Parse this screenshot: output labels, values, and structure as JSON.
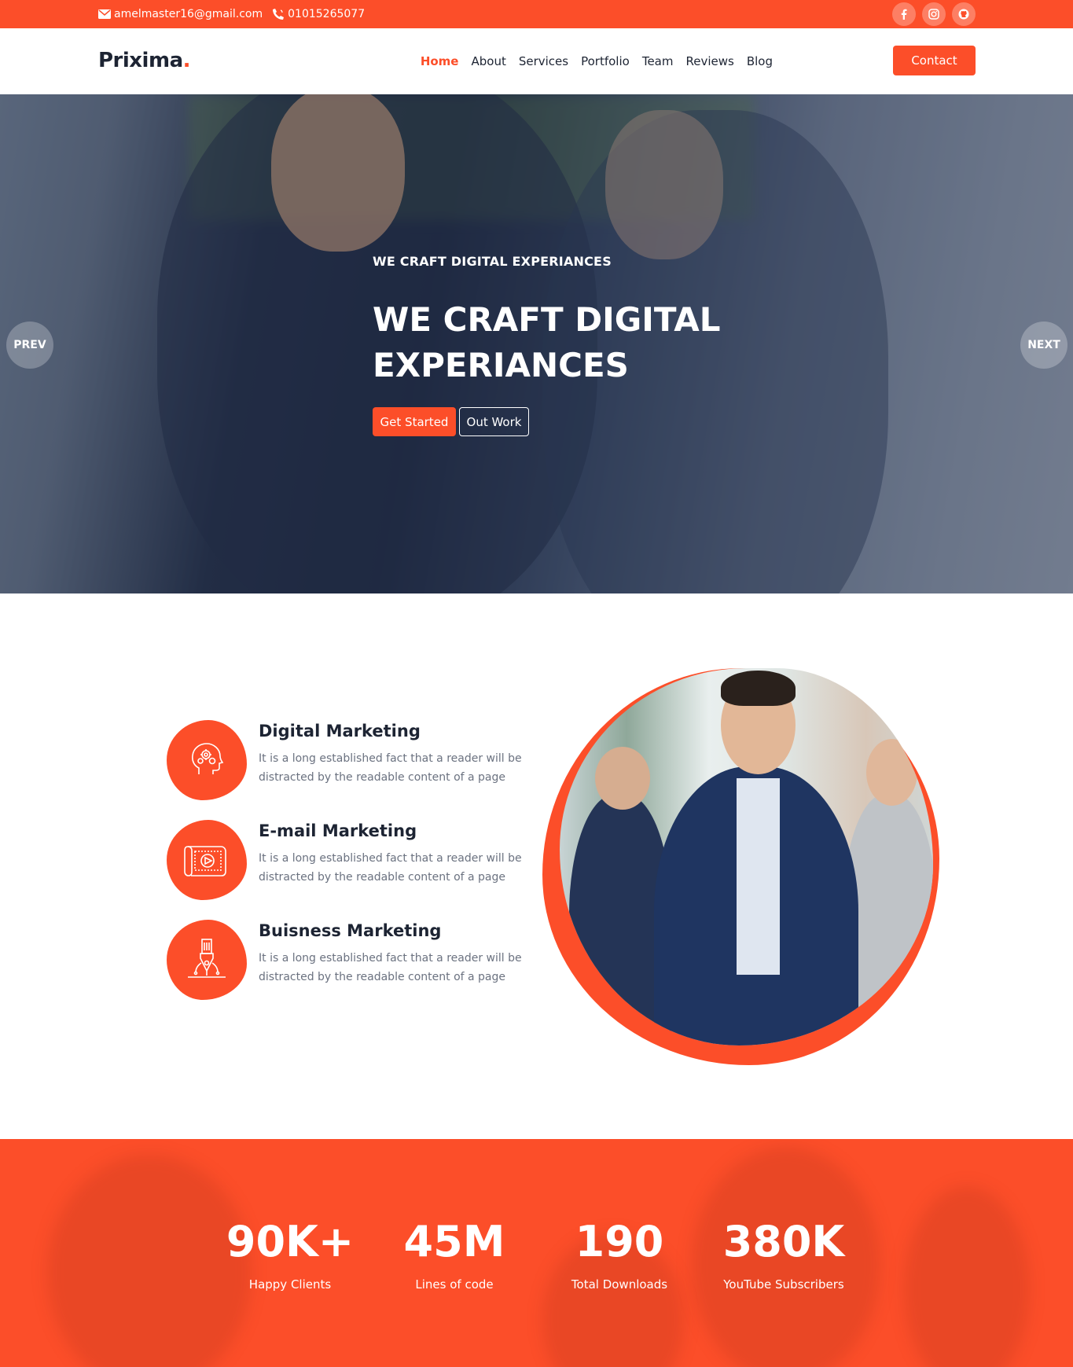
{
  "topbar": {
    "email": "amelmaster16@gmail.com",
    "phone": "01015265077",
    "socials": [
      "facebook-icon",
      "instagram-icon",
      "github-icon"
    ]
  },
  "header": {
    "logo": "Prixima",
    "logo_dot": ".",
    "nav": [
      "Home",
      "About",
      "Services",
      "Portfolio",
      "Team",
      "Reviews",
      "Blog"
    ],
    "active_nav": "Home",
    "contact_label": "Contact"
  },
  "hero": {
    "subtitle": "WE CRAFT DIGITAL EXPERIANCES",
    "title": "WE CRAFT DIGITAL EXPERIANCES",
    "primary_button": "Get Started",
    "secondary_button": "Out Work",
    "prev_label": "PREV",
    "next_label": "NEXT"
  },
  "services": [
    {
      "title": "Digital Marketing",
      "text": "It is a long established fact that a reader will be distracted by the readable content of a page",
      "icon": "brain-gear-icon"
    },
    {
      "title": "E-mail Marketing",
      "text": "It is a long established fact that a reader will be distracted by the readable content of a page",
      "icon": "video-scroll-icon"
    },
    {
      "title": "Buisness Marketing",
      "text": "It is a long established fact that a reader will be distracted by the readable content of a page",
      "icon": "pen-nib-icon"
    }
  ],
  "stats": [
    {
      "value": "90K+",
      "label": "Happy Clients"
    },
    {
      "value": "45M",
      "label": "Lines of code"
    },
    {
      "value": "190",
      "label": "Total Downloads"
    },
    {
      "value": "380K",
      "label": "YouTube Subscribers"
    }
  ],
  "colors": {
    "accent": "#fc4e29",
    "dark": "#1d2433",
    "muted": "#6b7280"
  }
}
